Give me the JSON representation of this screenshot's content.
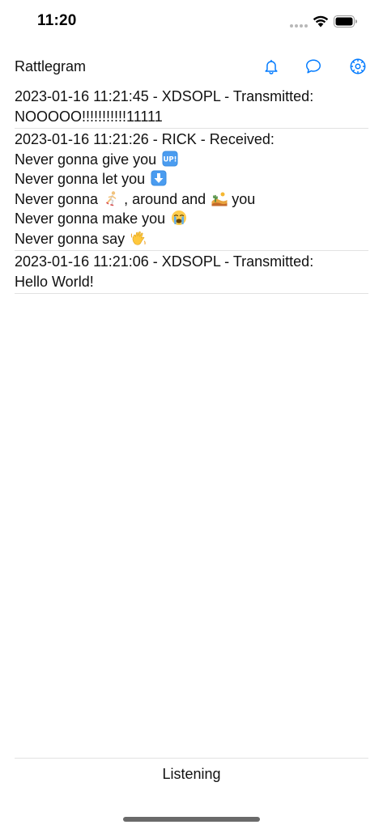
{
  "status_bar": {
    "time": "11:20",
    "wifi_icon": "wifi-icon",
    "battery_icon": "battery-icon"
  },
  "nav": {
    "title": "Rattlegram",
    "buttons": [
      {
        "icon": "bell-icon"
      },
      {
        "icon": "chat-bubble-icon"
      },
      {
        "icon": "gear-icon"
      }
    ],
    "accent_color": "#007aff"
  },
  "messages": [
    {
      "header": "2023-01-16 11:21:45 - XDSOPL - Transmitted:",
      "lines": [
        "NOOOOO!!!!!!!!!!!11111"
      ]
    },
    {
      "header": "2023-01-16 11:21:26 - RICK - Received:",
      "lines": [
        "Never gonna give you",
        "Never gonna let you",
        "Never gonna",
        ", around and",
        "you",
        "Never gonna make you",
        "Never gonna say"
      ],
      "emojis": [
        "up-button-emoji",
        "down-arrow-emoji",
        "running-person-emoji",
        "desert-emoji",
        "crying-face-emoji",
        "waving-hand-emoji"
      ]
    },
    {
      "header": "2023-01-16 11:21:06 - XDSOPL - Transmitted:",
      "lines": [
        "Hello World!"
      ]
    }
  ],
  "footer": {
    "status": "Listening"
  }
}
